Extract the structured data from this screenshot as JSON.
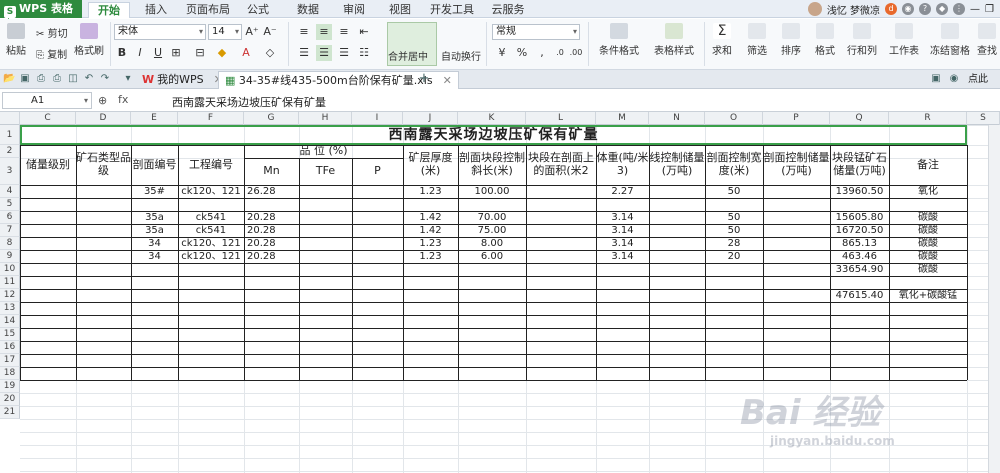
{
  "app": {
    "name": "WPS 表格",
    "logo": "S"
  },
  "ribbon_tabs": [
    "开始",
    "插入",
    "页面布局",
    "公式",
    "数据",
    "审阅",
    "视图",
    "开发工具",
    "云服务"
  ],
  "user": {
    "name": "浅忆 梦微凉"
  },
  "ribbon": {
    "paste": "粘贴",
    "cut": "剪切",
    "copy": "复制",
    "format_painter": "格式刷",
    "font_name": "宋体",
    "font_size": "14",
    "merge_center": "合并居中",
    "wrap_text": "自动换行",
    "number_format": "常规",
    "conditional_format": "条件格式",
    "table_style": "表格样式",
    "sum": "求和",
    "filter": "筛选",
    "sort": "排序",
    "format": "格式",
    "rows_cols": "行和列",
    "worksheet": "工作表",
    "freeze": "冻结窗格",
    "find": "查找"
  },
  "doc_tabs": [
    {
      "label": "我的WPS",
      "active": false
    },
    {
      "label": "34-35#线435-500m台阶保有矿量.xls",
      "active": true
    }
  ],
  "doc_right_label": "点此",
  "formula_bar": {
    "name_box": "A1",
    "fx": "fx",
    "content": "西南露天采场边坡压矿保有矿量"
  },
  "columns": [
    "C",
    "D",
    "E",
    "F",
    "G",
    "H",
    "I",
    "J",
    "K",
    "L",
    "M",
    "N",
    "O",
    "P",
    "Q",
    "R",
    "S"
  ],
  "rows": [
    "1",
    "2",
    "3",
    "4",
    "5",
    "6",
    "7",
    "8",
    "9",
    "10",
    "11",
    "12",
    "13",
    "14",
    "15",
    "16",
    "17",
    "18",
    "19",
    "20",
    "21"
  ],
  "sheet": {
    "title": "西南露天采场边坡压矿保有矿量",
    "headers": {
      "reserve_level": "储量级别",
      "ore_type": "矿石类型品级",
      "section_no": "剖面编号",
      "project_no": "工程编号",
      "grade": "品  位  (%)",
      "mn": "Mn",
      "tfe": "TFe",
      "p": "P",
      "thickness": "矿层厚度(米)",
      "slope_length": "剖面块段控制斜长(米)",
      "area": "块段在剖面上的面积(米2",
      "density": "体重(吨/米3)",
      "line_reserve": "线控制储量(万吨)",
      "section_width": "剖面控制宽度(米)",
      "section_reserve": "剖面控制储量(万吨)",
      "block_reserve": "块段锰矿石储量(万吨)",
      "remark": "备注"
    },
    "data_rows": [
      {
        "row": 4,
        "section": "35#",
        "project": "ck120、121",
        "mn": "26.28",
        "thickness": "1.23",
        "slope": "100.00",
        "density": "2.27",
        "width": "50",
        "block": "13960.50",
        "remark": "氧化"
      },
      {
        "row": 6,
        "section": "35a",
        "project": "ck541",
        "mn": "20.28",
        "thickness": "1.42",
        "slope": "70.00",
        "density": "3.14",
        "width": "50",
        "block": "15605.80",
        "remark": "碳酸"
      },
      {
        "row": 7,
        "section": "35a",
        "project": "ck541",
        "mn": "20.28",
        "thickness": "1.42",
        "slope": "75.00",
        "density": "3.14",
        "width": "50",
        "block": "16720.50",
        "remark": "碳酸"
      },
      {
        "row": 8,
        "section": "34",
        "project": "ck120、121",
        "mn": "20.28",
        "thickness": "1.23",
        "slope": "8.00",
        "density": "3.14",
        "width": "28",
        "block": "865.13",
        "remark": "碳酸"
      },
      {
        "row": 9,
        "section": "34",
        "project": "ck120、121",
        "mn": "20.28",
        "thickness": "1.23",
        "slope": "6.00",
        "density": "3.14",
        "width": "20",
        "block": "463.46",
        "remark": "碳酸"
      },
      {
        "row": 10,
        "section": "",
        "project": "",
        "mn": "",
        "thickness": "",
        "slope": "",
        "density": "",
        "width": "",
        "block": "33654.90",
        "remark": "碳酸"
      },
      {
        "row": 12,
        "section": "",
        "project": "",
        "mn": "",
        "thickness": "",
        "slope": "",
        "density": "",
        "width": "",
        "block": "47615.40",
        "remark": "氧化+碳酸锰"
      }
    ]
  },
  "watermark": {
    "main": "Bai 经验",
    "sub": "jingyan.baidu.com"
  },
  "colors": {
    "accent": "#2e8b3e",
    "selection": "#3aa04a"
  }
}
